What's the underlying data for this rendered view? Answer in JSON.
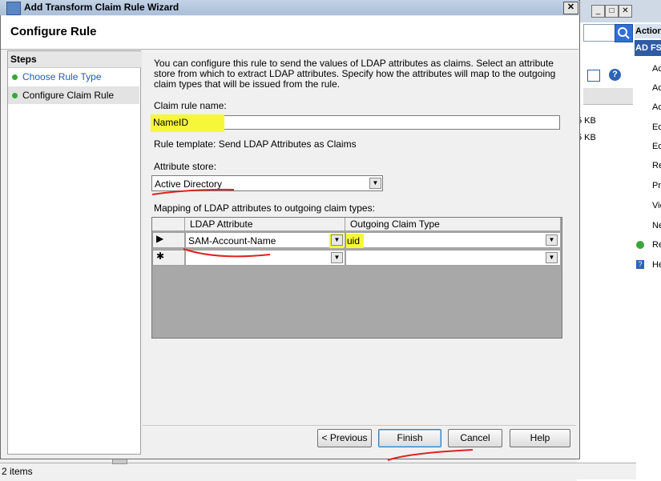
{
  "dialog": {
    "title": "Add Transform Claim Rule Wizard",
    "close_glyph": "✕",
    "page_title": "Configure Rule"
  },
  "steps": {
    "header": "Steps",
    "items": [
      {
        "label": "Choose Rule Type",
        "state": "done"
      },
      {
        "label": "Configure Claim Rule",
        "state": "current"
      }
    ]
  },
  "main": {
    "description": "You can configure this rule to send the values of LDAP attributes as claims. Select an attribute store from which to extract LDAP attributes. Specify how the attributes will map to the outgoing claim types that will be issued from the rule.",
    "claim_rule_name_label": "Claim rule name:",
    "claim_rule_name_value": "NameID",
    "rule_template_text": "Rule template: Send LDAP Attributes as Claims",
    "attribute_store_label": "Attribute store:",
    "attribute_store_value": "Active Directory",
    "mapping_label": "Mapping of LDAP attributes to outgoing claim types:",
    "grid": {
      "columns": [
        "LDAP Attribute",
        "Outgoing Claim Type"
      ],
      "rows": [
        {
          "marker": "▶",
          "ldap": "SAM-Account-Name",
          "claim": "uid"
        },
        {
          "marker": "✱",
          "ldap": "",
          "claim": ""
        }
      ]
    }
  },
  "buttons": {
    "previous": "< Previous",
    "finish": "Finish",
    "cancel": "Cancel",
    "help": "Help"
  },
  "background": {
    "actions_header": "Actions",
    "adfs_header": "AD FS",
    "size_values": [
      "5 KB",
      "5 KB"
    ],
    "action_items": [
      "Ac",
      "Ac",
      "Ac",
      "Ed",
      "Ed",
      "Re",
      "Pr",
      "Vie",
      "Ne",
      "Re",
      "He"
    ],
    "status_text": "2 items"
  },
  "colors": {
    "highlight": "#f7f73a",
    "annotation_red": "#e0201e",
    "step_done": "#3aa63a"
  }
}
